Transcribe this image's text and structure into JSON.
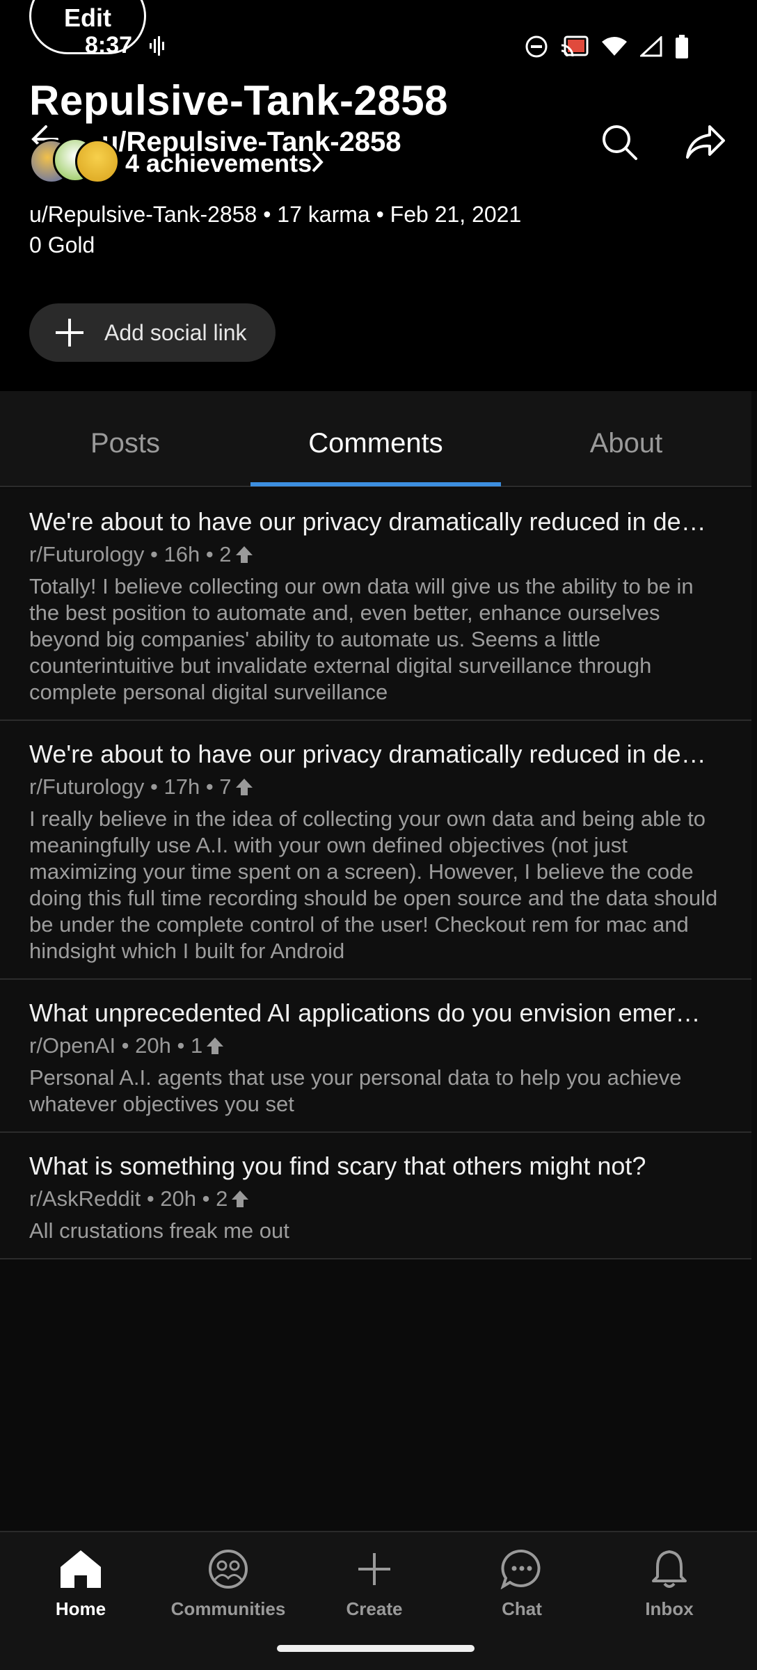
{
  "status_bar": {
    "time": "8:37"
  },
  "edit_button": {
    "label": "Edit"
  },
  "profile": {
    "display_name": "Repulsive-Tank-2858",
    "nav_username": "u/Repulsive-Tank-2858",
    "achievements": "4 achievements",
    "meta": "u/Repulsive-Tank-2858 • 17 karma • Feb 21, 2021",
    "gold": "0 Gold",
    "social_button": "Add social link"
  },
  "tabs": [
    {
      "label": "Posts",
      "active": false
    },
    {
      "label": "Comments",
      "active": true
    },
    {
      "label": "About",
      "active": false
    }
  ],
  "comments": [
    {
      "title": "We're about to have our privacy dramatically reduced in de…",
      "meta": "r/Futurology • 16h • 2",
      "body": "Totally! I believe collecting our own data will give us the ability to be in the best position to automate and, even better, enhance ourselves beyond big companies' ability to automate us. Seems a little counterintuitive but invalidate external digital surveillance through complete personal digital surveillance"
    },
    {
      "title": "We're about to have our privacy dramatically reduced in de…",
      "meta": "r/Futurology • 17h • 7",
      "body": "I really believe in the idea of collecting your own data and being able to meaningfully use A.I. with your own defined objectives (not just maximizing your time spent on a screen). However, I believe the code doing this full time recording should be open source and the data should be under the complete control of the user!  Checkout rem for mac and hindsight which I built for Android"
    },
    {
      "title": "What unprecedented AI applications do you envision emer…",
      "meta": "r/OpenAI • 20h • 1",
      "body": "Personal A.I. agents that use your personal data to help you achieve whatever objectives you set"
    },
    {
      "title": "What is something you find scary that others might not?",
      "meta": "r/AskReddit • 20h • 2",
      "body": "All crustations freak me out"
    }
  ],
  "bottom_nav": [
    {
      "label": "Home",
      "icon": "home-icon",
      "active": true
    },
    {
      "label": "Communities",
      "icon": "communities-icon",
      "active": false
    },
    {
      "label": "Create",
      "icon": "plus-icon",
      "active": false
    },
    {
      "label": "Chat",
      "icon": "chat-icon",
      "active": false
    },
    {
      "label": "Inbox",
      "icon": "bell-icon",
      "active": false
    }
  ],
  "colors": {
    "accent": "#3d8fe0",
    "background": "#0f0f0f",
    "header": "#000000"
  }
}
